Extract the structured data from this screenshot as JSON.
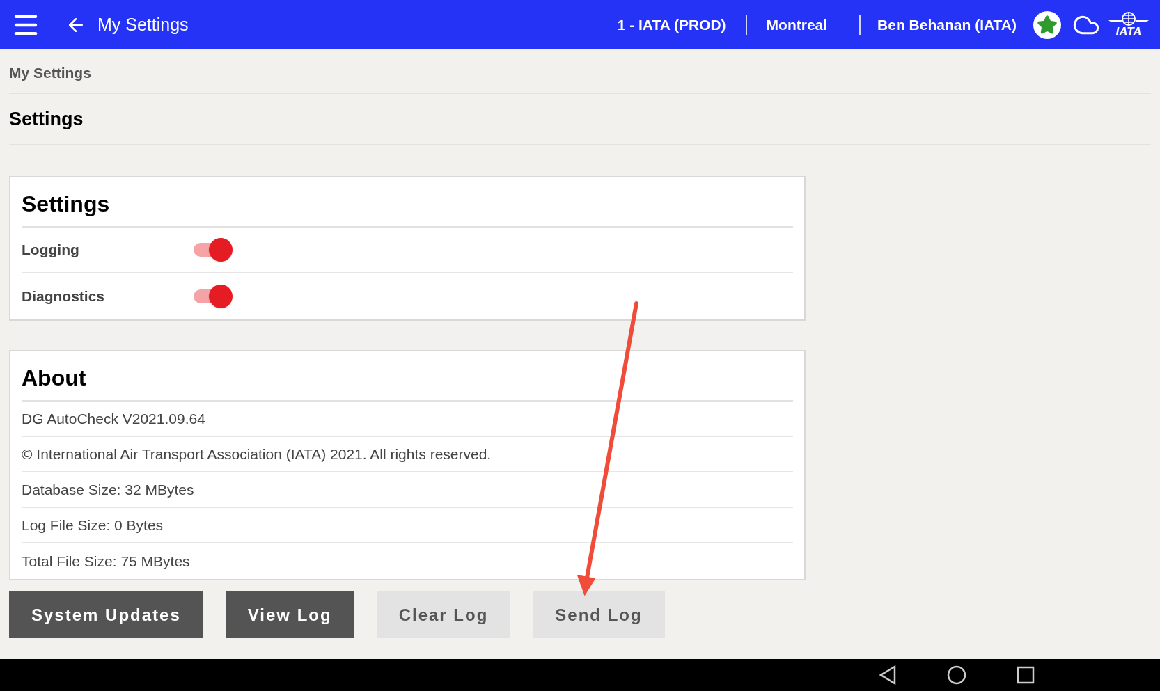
{
  "header": {
    "title": "My Settings",
    "account": "1 - IATA (PROD)",
    "location": "Montreal",
    "user": "Ben Behanan (IATA)",
    "logo_text": "IATA"
  },
  "breadcrumb": "My Settings",
  "page_title": "Settings",
  "settings": {
    "title": "Settings",
    "toggles": [
      {
        "label": "Logging",
        "on": true
      },
      {
        "label": "Diagnostics",
        "on": true
      }
    ]
  },
  "about": {
    "title": "About",
    "lines": [
      "DG AutoCheck V2021.09.64",
      "© International Air Transport Association (IATA) 2021. All rights reserved.",
      "Database Size: 32 MBytes",
      "Log File Size: 0 Bytes",
      "Total File Size: 75 MBytes"
    ]
  },
  "buttons": [
    {
      "label": "System Updates",
      "disabled": false
    },
    {
      "label": "View Log",
      "disabled": false
    },
    {
      "label": "Clear Log",
      "disabled": true
    },
    {
      "label": "Send Log",
      "disabled": true
    }
  ]
}
